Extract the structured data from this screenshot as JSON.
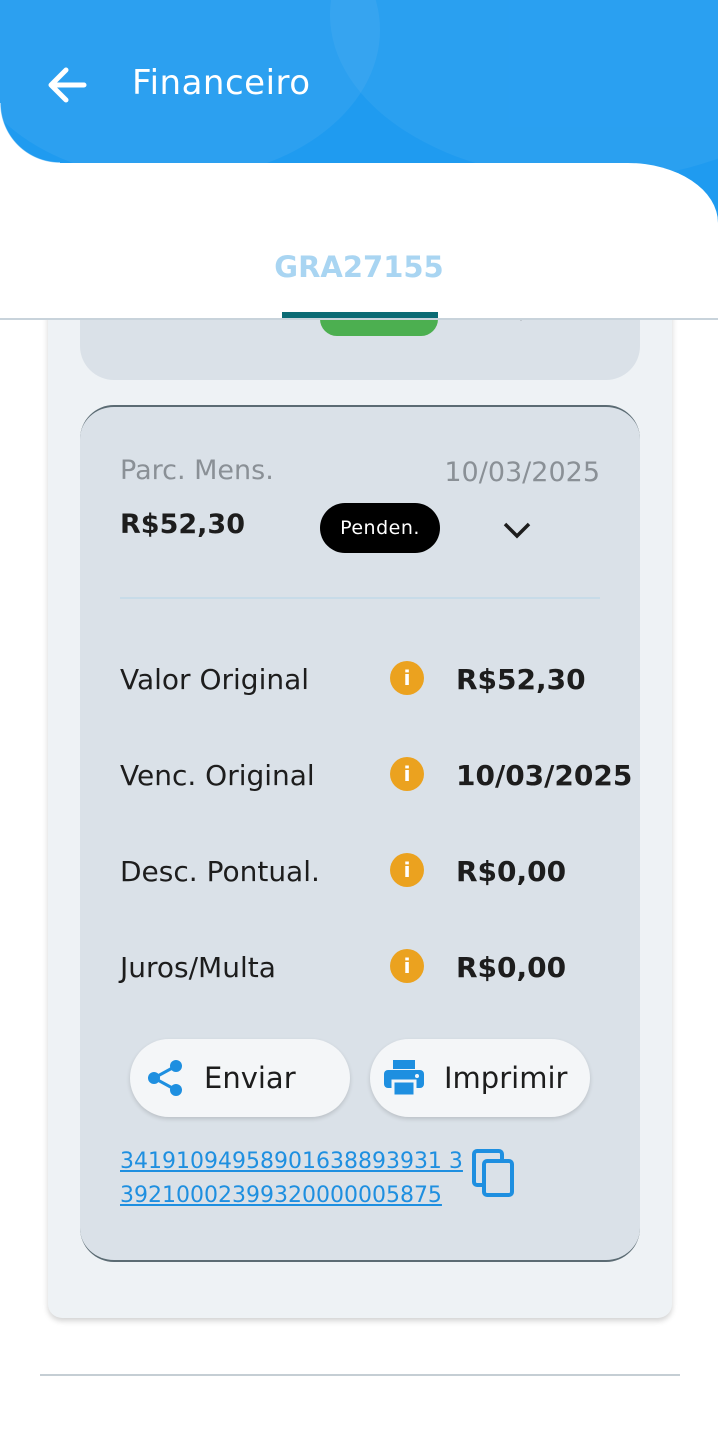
{
  "header": {
    "title": "Financeiro",
    "back_icon": "arrow-left-icon",
    "color": "#1f9bf0"
  },
  "tabs": [
    {
      "label": "GRA27155",
      "selected": true
    }
  ],
  "installment": {
    "type_label": "Parc. Mens.",
    "due_date": "10/03/2025",
    "amount": "R$52,30",
    "status": "Penden.",
    "rows": [
      {
        "label": "Valor Original",
        "value": "R$52,30"
      },
      {
        "label": "Venc. Original",
        "value": "10/03/2025"
      },
      {
        "label": "Desc. Pontual.",
        "value": "R$0,00"
      },
      {
        "label": "Juros/Multa",
        "value": "R$0,00"
      }
    ],
    "send_label": "Enviar",
    "print_label": "Imprimir",
    "barcode_line1": "34191094958901638893931 3",
    "barcode_line2": "39210002399320000005875"
  },
  "colors": {
    "accent": "#1e8fe0",
    "info": "#eba21f",
    "status_prev": "#4caf50"
  }
}
